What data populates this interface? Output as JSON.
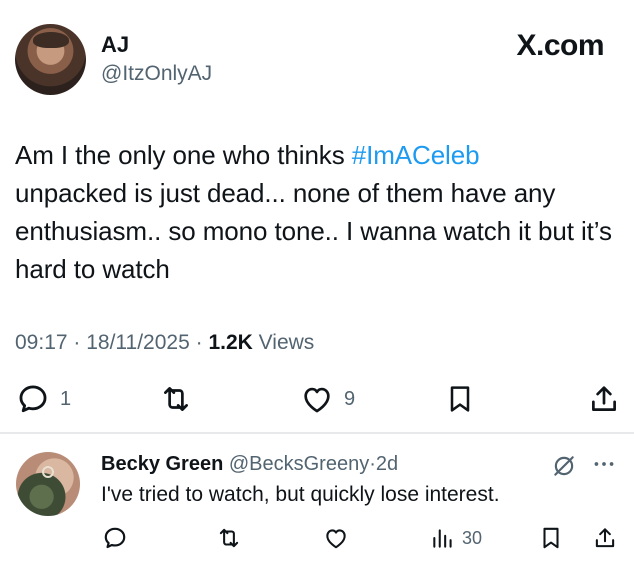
{
  "tweet": {
    "author_name": "AJ",
    "author_handle": "@ItzOnlyAJ",
    "brand": "X.com",
    "text_before": "Am I the only one who thinks ",
    "hashtag": "#ImACeleb",
    "text_after": "unpacked is just dead... none of them have any enthusiasm.. so mono tone.. I wanna watch it but it’s hard to watch",
    "time": "09:17",
    "date": "18/11/2025",
    "views_count": "1.2K",
    "views_label": "Views",
    "sep": " · ",
    "reply_count": "1",
    "like_count": "9",
    "icons": [
      "reply-icon",
      "retweet-icon",
      "like-icon",
      "bookmark-icon",
      "share-icon"
    ]
  },
  "reply": {
    "author_name": "Becky Green",
    "author_handle": "@BecksGreeny",
    "age": "2d",
    "sep": "·",
    "text": "I've tried to watch, but quickly lose interest.",
    "views_count": "30",
    "icons": [
      "grok-icon",
      "more-icon",
      "reply-icon",
      "retweet-icon",
      "like-icon",
      "views-icon",
      "bookmark-icon",
      "share-icon"
    ]
  },
  "colors": {
    "text": "#0f1419",
    "secondary": "#536471",
    "link": "#1d9bf0",
    "divider": "#e7e9ea"
  }
}
